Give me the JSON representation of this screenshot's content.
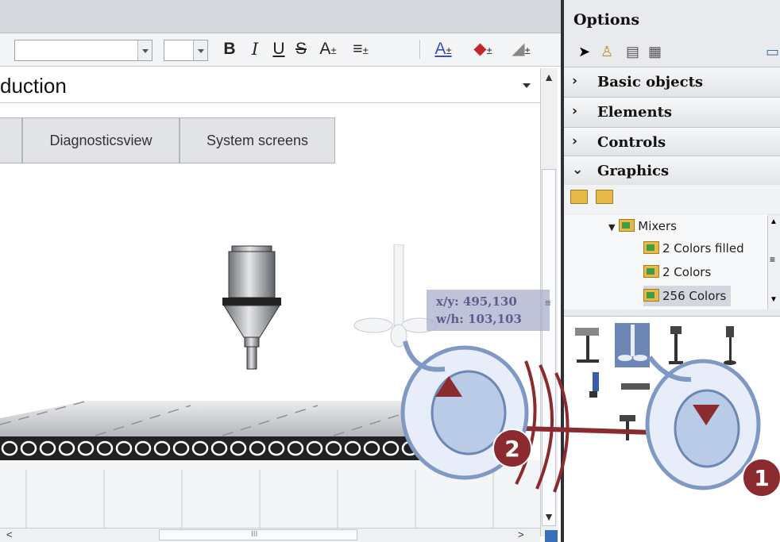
{
  "editor": {
    "screen_title": "duction",
    "nav_tabs": [
      {
        "label": "Diagnosticsview"
      },
      {
        "label": "System screens"
      }
    ],
    "toolbar": {
      "bold": "B",
      "italic": "I",
      "underline": "U",
      "strike": "S",
      "font_size_symbol": "A",
      "align_symbol": "≡",
      "font_color_symbol": "A",
      "fill_symbol": "◆",
      "line_symbol": "◢"
    },
    "coord": {
      "xy_label": "x/y:",
      "xy_value": "495,130",
      "wh_label": "w/h:",
      "wh_value": "103,103"
    },
    "scroll": {
      "h_thumb_grip": "III"
    }
  },
  "options": {
    "title": "Options",
    "categories": [
      {
        "label": "Basic objects",
        "expanded": false
      },
      {
        "label": "Elements",
        "expanded": false
      },
      {
        "label": "Controls",
        "expanded": false
      },
      {
        "label": "Graphics",
        "expanded": true
      }
    ],
    "tree": {
      "parent": "Mixers",
      "children": [
        "2 Colors filled",
        "2 Colors",
        "256 Colors"
      ],
      "selected_index": 2
    }
  },
  "callouts": {
    "badge_1": "1",
    "badge_2": "2",
    "color": "#8b2b30"
  },
  "colors": {
    "accent": "#6c86b6",
    "panel_bg": "#e8eaee",
    "tooltip_bg": "#aab0cd"
  }
}
